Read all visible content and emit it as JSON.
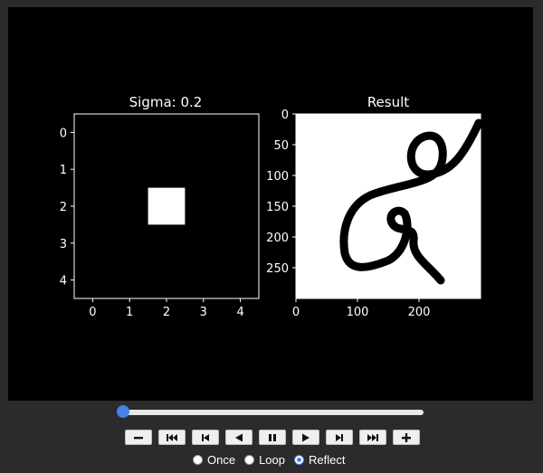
{
  "figure": {
    "left_panel": {
      "title": "Sigma: 0.2",
      "x_ticks": [
        "0",
        "1",
        "2",
        "3",
        "4"
      ],
      "y_ticks": [
        "0",
        "1",
        "2",
        "3",
        "4"
      ],
      "kernel_size": 5,
      "kernel_bright_cell": [
        2,
        2
      ]
    },
    "right_panel": {
      "title": "Result",
      "x_ticks": [
        "0",
        "100",
        "200"
      ],
      "y_ticks": [
        "0",
        "50",
        "100",
        "150",
        "200",
        "250"
      ],
      "x_range": [
        0,
        300
      ],
      "y_range": [
        0,
        300
      ]
    }
  },
  "animation": {
    "frame_fraction": 0.0,
    "modes": [
      "Once",
      "Loop",
      "Reflect"
    ],
    "selected_mode": "Reflect"
  },
  "colors": {
    "figure_bg": "#000000",
    "page_bg": "#2b2b2b",
    "accent": "#4a7fe6"
  }
}
